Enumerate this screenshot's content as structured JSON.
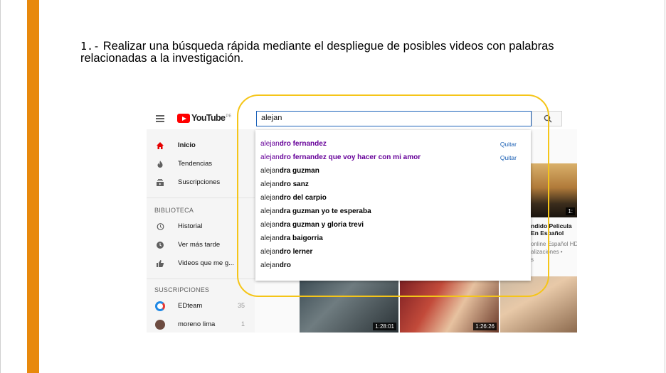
{
  "instruction": {
    "number": "1.-",
    "text": "Realizar una búsqueda rápida mediante el despliegue de posibles videos con palabras relacionadas a la investigación."
  },
  "youtube": {
    "logo_text": "YouTube",
    "country_code": "PE",
    "search_value": "alejan"
  },
  "sidebar": {
    "nav": [
      {
        "label": "Inicio",
        "icon": "home-icon"
      },
      {
        "label": "Tendencias",
        "icon": "flame-icon"
      },
      {
        "label": "Suscripciones",
        "icon": "subscriptions-icon"
      }
    ],
    "library_heading": "BIBLIOTECA",
    "library": [
      {
        "label": "Historial",
        "icon": "history-icon"
      },
      {
        "label": "Ver más tarde",
        "icon": "clock-icon"
      },
      {
        "label": "Videos que me g...",
        "icon": "thumbs-up-icon"
      }
    ],
    "subs_heading": "SUSCRIPCIONES",
    "subscriptions": [
      {
        "label": "EDteam",
        "count": "35",
        "avatar_color": "#1E88E5"
      },
      {
        "label": "moreno lima",
        "count": "1",
        "avatar_color": "#6d4c41"
      }
    ]
  },
  "suggestions": {
    "typed_prefix": "alejan",
    "remove_label": "Quitar",
    "items": [
      {
        "rest": "dro fernandez",
        "visited": true
      },
      {
        "rest": "dro fernandez que voy hacer con mi amor",
        "visited": true
      },
      {
        "rest": "dra guzman",
        "visited": false
      },
      {
        "rest": "dro sanz",
        "visited": false
      },
      {
        "rest": "dro del carpio",
        "visited": false
      },
      {
        "rest": "dra guzman yo te esperaba",
        "visited": false
      },
      {
        "rest": "dra guzman y gloria trevi",
        "visited": false
      },
      {
        "rest": "dra baigorria",
        "visited": false
      },
      {
        "rest": "dro lerner",
        "visited": false
      },
      {
        "rest": "dro",
        "visited": false
      }
    ]
  },
  "videos": {
    "side_title_1": "ndido Pelicula",
    "side_title_2": "En Español",
    "side_meta_1": "online Español HD",
    "side_meta_2": "alizaciones •",
    "side_meta_3": "s",
    "durations": [
      "1:28:01",
      "1:26:26",
      "1:"
    ],
    "top_right_duration": "1:"
  },
  "colors": {
    "accent_bar": "#E8890C",
    "highlight_ring": "#F5C518",
    "youtube_red": "#FF0000",
    "visited_link": "#660099",
    "search_border": "#1c62b9"
  }
}
